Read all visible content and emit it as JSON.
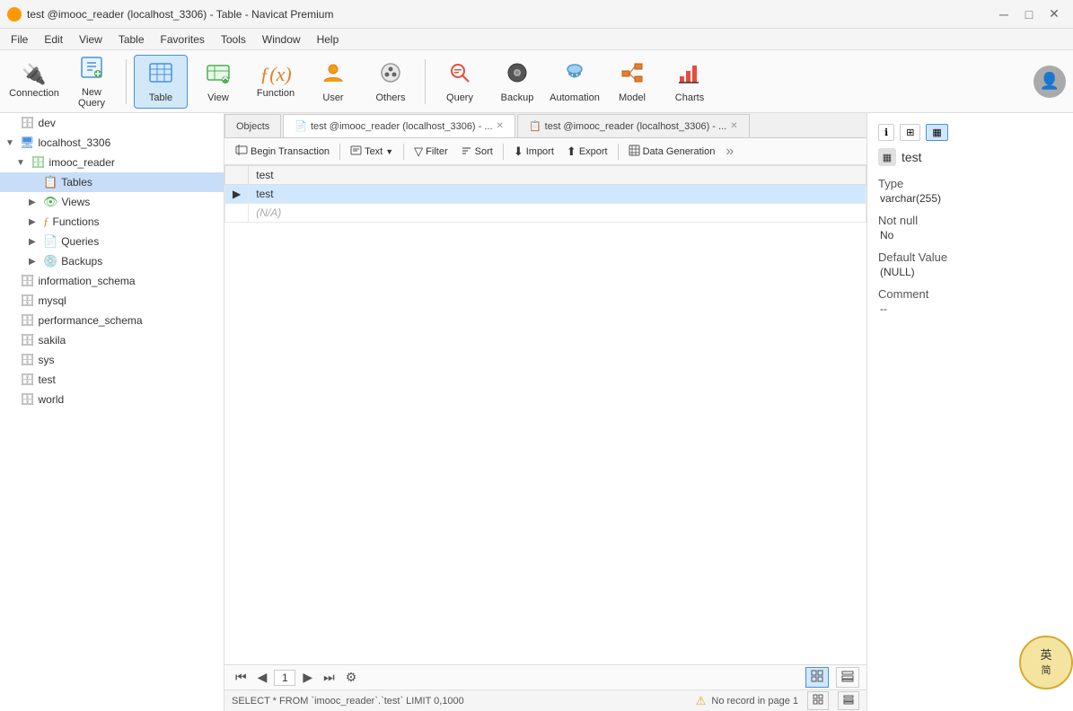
{
  "window": {
    "title": "test @imooc_reader (localhost_3306) - Table - Navicat Premium",
    "icon": "🟡"
  },
  "title_controls": {
    "minimize": "─",
    "maximize": "□",
    "close": "✕"
  },
  "menu": {
    "items": [
      "File",
      "Edit",
      "View",
      "Table",
      "Favorites",
      "Tools",
      "Window",
      "Help"
    ]
  },
  "toolbar": {
    "items": [
      {
        "id": "connection",
        "icon": "🔌",
        "label": "Connection"
      },
      {
        "id": "new-query",
        "icon": "📝",
        "label": "New Query"
      },
      {
        "id": "table",
        "icon": "📊",
        "label": "Table",
        "active": true
      },
      {
        "id": "view",
        "icon": "👁",
        "label": "View"
      },
      {
        "id": "function",
        "icon": "ƒ(x)",
        "label": "Function"
      },
      {
        "id": "user",
        "icon": "👤",
        "label": "User"
      },
      {
        "id": "others",
        "icon": "⚙",
        "label": "Others"
      },
      {
        "id": "query",
        "icon": "🔍",
        "label": "Query"
      },
      {
        "id": "backup",
        "icon": "💿",
        "label": "Backup"
      },
      {
        "id": "automation",
        "icon": "🤖",
        "label": "Automation"
      },
      {
        "id": "model",
        "icon": "🧩",
        "label": "Model"
      },
      {
        "id": "charts",
        "icon": "📊",
        "label": "Charts"
      }
    ]
  },
  "sidebar": {
    "items": [
      {
        "id": "dev",
        "label": "dev",
        "level": 0,
        "icon": "🗄",
        "arrow": ""
      },
      {
        "id": "localhost",
        "label": "localhost_3306",
        "level": 0,
        "icon": "🖥",
        "arrow": "▼"
      },
      {
        "id": "imooc_reader",
        "label": "imooc_reader",
        "level": 1,
        "icon": "🗄",
        "arrow": "▼"
      },
      {
        "id": "tables",
        "label": "Tables",
        "level": 2,
        "icon": "📋",
        "arrow": "",
        "selected": true
      },
      {
        "id": "views",
        "label": "Views",
        "level": 2,
        "icon": "👁",
        "arrow": "▶"
      },
      {
        "id": "functions",
        "label": "Functions",
        "level": 2,
        "icon": "ƒ",
        "arrow": "▶"
      },
      {
        "id": "queries",
        "label": "Queries",
        "level": 2,
        "icon": "📄",
        "arrow": "▶"
      },
      {
        "id": "backups",
        "label": "Backups",
        "level": 2,
        "icon": "💿",
        "arrow": "▶"
      },
      {
        "id": "information_schema",
        "label": "information_schema",
        "level": 0,
        "icon": "🗄",
        "arrow": ""
      },
      {
        "id": "mysql",
        "label": "mysql",
        "level": 0,
        "icon": "🗄",
        "arrow": ""
      },
      {
        "id": "performance_schema",
        "label": "performance_schema",
        "level": 0,
        "icon": "🗄",
        "arrow": ""
      },
      {
        "id": "sakila",
        "label": "sakila",
        "level": 0,
        "icon": "🗄",
        "arrow": ""
      },
      {
        "id": "sys",
        "label": "sys",
        "level": 0,
        "icon": "🗄",
        "arrow": ""
      },
      {
        "id": "test",
        "label": "test",
        "level": 0,
        "icon": "🗄",
        "arrow": ""
      },
      {
        "id": "world",
        "label": "world",
        "level": 0,
        "icon": "🗄",
        "arrow": ""
      }
    ]
  },
  "tabs": [
    {
      "id": "objects",
      "label": "Objects",
      "closable": false
    },
    {
      "id": "tab1",
      "label": "test @imooc_reader (localhost_3306) - ...",
      "closable": true,
      "icon": "📄"
    },
    {
      "id": "tab2",
      "label": "test @imooc_reader (localhost_3306) - ...",
      "closable": true,
      "icon": "📋"
    }
  ],
  "data_toolbar": {
    "begin_transaction": "Begin Transaction",
    "text": "Text",
    "filter": "Filter",
    "sort": "Sort",
    "import": "Import",
    "export": "Export",
    "data_generation": "Data Generation"
  },
  "table_data": {
    "columns": [
      "test"
    ],
    "rows": [
      {
        "indicator": "",
        "data": [
          "test"
        ]
      }
    ],
    "new_row": "(N/A)"
  },
  "right_panel": {
    "toolbar_icons": [
      "ℹ",
      "⊞",
      "▦"
    ],
    "field_name": "test",
    "field_icon": "▦",
    "type_label": "Type",
    "type_value": "varchar(255)",
    "not_null_label": "Not null",
    "not_null_value": "No",
    "default_value_label": "Default Value",
    "default_value": "(NULL)",
    "comment_label": "Comment",
    "comment_value": "--"
  },
  "pagination": {
    "first": "⏮",
    "prev": "◀",
    "page": "1",
    "next": "▶",
    "last": "⏭",
    "settings": "⚙",
    "grid_icon": "▦",
    "list_icon": "≡"
  },
  "status_bar": {
    "query": "SELECT * FROM `imooc_reader`.`test` LIMIT 0,1000",
    "warning": "⚠",
    "message": "No record in page 1",
    "layout_icon1": "▦",
    "layout_icon2": "≡"
  },
  "lang_overlay": "英\n简"
}
